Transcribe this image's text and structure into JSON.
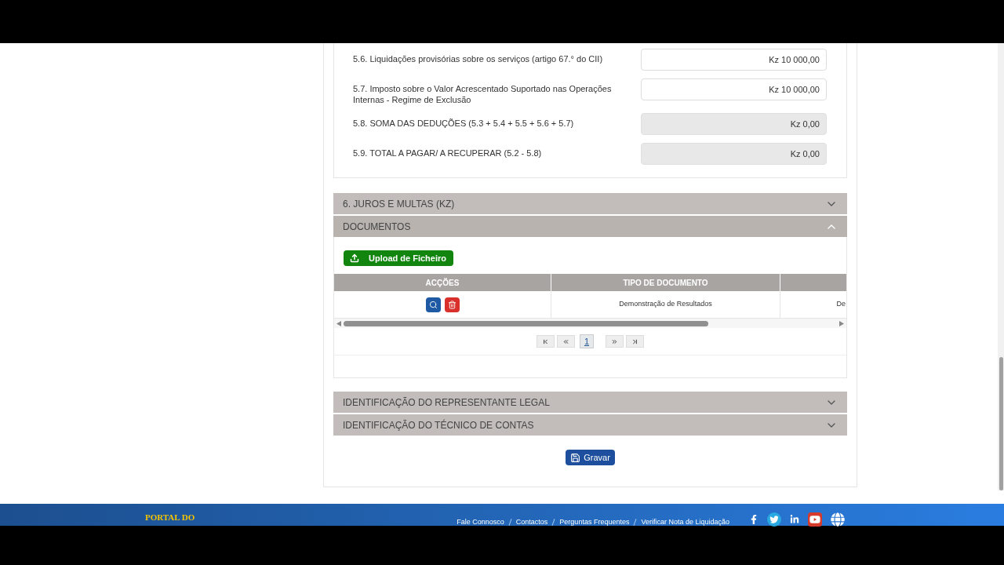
{
  "deductions": [
    {
      "label": "5.6. Liquidações provisórias sobre os serviços (artigo 67.° do CII)",
      "value": "Kz 10 000,00",
      "disabled": false
    },
    {
      "label": "5.7. Imposto sobre o Valor Acrescentado Suportado nas Operações Internas - Regime de Exclusão",
      "value": "Kz 10 000,00",
      "disabled": false
    },
    {
      "label": "5.8. SOMA DAS DEDUÇÕES (5.3 + 5.4 + 5.5 + 5.6 + 5.7)",
      "value": "Kz 0,00",
      "disabled": true
    },
    {
      "label": "5.9. TOTAL A PAGAR/ A RECUPERAR (5.2 - 5.8)",
      "value": "Kz 0,00",
      "disabled": true
    }
  ],
  "sections_before": [
    {
      "title": "6. JUROS E MULTAS (KZ)",
      "expanded": false
    },
    {
      "title": "DOCUMENTOS",
      "expanded": true
    }
  ],
  "documents": {
    "upload_button": "Upload de Ficheiro",
    "columns": [
      "ACÇÕES",
      "TIPO DE DOCUMENTO"
    ],
    "rows": [
      {
        "tipo": "Demonstração de Resultados",
        "column_3": "De"
      }
    ],
    "pages": [
      {
        "label": "1",
        "selected": true
      }
    ]
  },
  "sections_after": [
    {
      "title": "IDENTIFICAÇÃO DO REPRESENTANTE LEGAL",
      "expanded": false
    },
    {
      "title": "IDENTIFICAÇÃO DO TÉCNICO DE CONTAS",
      "expanded": false
    }
  ],
  "save_button": "Gravar",
  "footer": {
    "logo": "PORTAL DO",
    "links": [
      "Fale Connosco",
      "Contactos",
      "Perguntas Frequentes",
      "Verificar Nota de Liquidação"
    ]
  }
}
